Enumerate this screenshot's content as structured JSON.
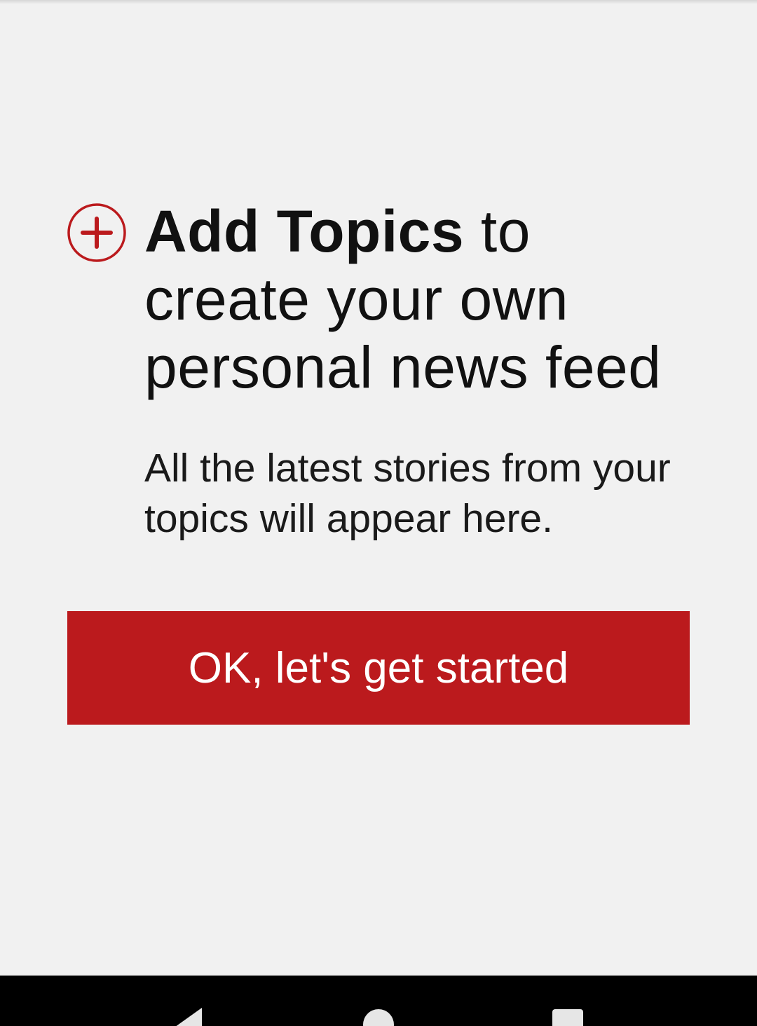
{
  "onboarding": {
    "headline_bold": "Add Topics",
    "headline_rest": " to create your own personal news feed",
    "subtext": "All the latest stories from your topics will appear here.",
    "cta_label": "OK, let's get started",
    "add_icon": "plus-circle-icon"
  },
  "colors": {
    "accent": "#bb1a1d",
    "background": "#f1f1f1",
    "navbar": "#000000"
  },
  "navbar": {
    "icons": [
      "back-icon",
      "home-icon",
      "recents-icon"
    ]
  }
}
